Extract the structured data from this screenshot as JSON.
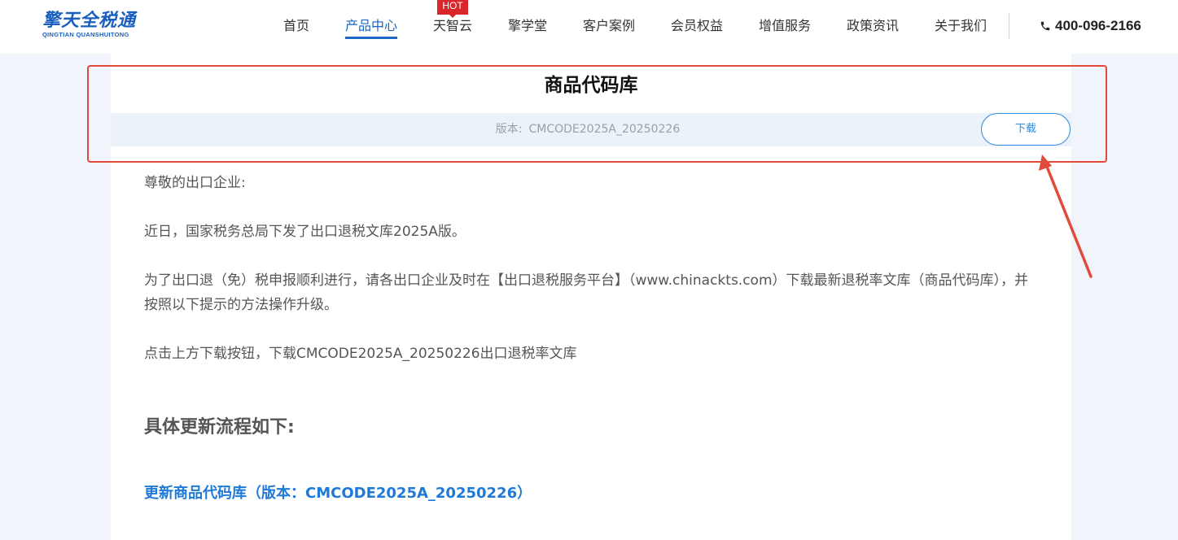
{
  "header": {
    "logo_cn": "擎天全税通",
    "logo_en": "QINGTIAN QUANSHUITONG",
    "nav": [
      {
        "label": "首页"
      },
      {
        "label": "产品中心"
      },
      {
        "label": "天智云"
      },
      {
        "label": "擎学堂"
      },
      {
        "label": "客户案例"
      },
      {
        "label": "会员权益"
      },
      {
        "label": "增值服务"
      },
      {
        "label": "政策资讯"
      },
      {
        "label": "关于我们"
      }
    ],
    "hot_badge": "HOT",
    "phone": "400-096-2166"
  },
  "main": {
    "title": "商品代码库",
    "version_label": "版本:",
    "version_value": "CMCODE2025A_20250226",
    "download_label": "下载",
    "paragraphs": [
      "尊敬的出口企业:",
      "近日，国家税务总局下发了出口退税文库2025A版。",
      "为了出口退（免）税申报顺利进行，请各出口企业及时在【出口退税服务平台】（www.chinackts.com）下载最新退税率文库（商品代码库），并按照以下提示的方法操作升级。",
      "点击上方下载按钮，下载CMCODE2025A_20250226出口退税率文库"
    ],
    "sub_heading": "具体更新流程如下:",
    "link_heading": "更新商品代码库（版本：CMCODE2025A_20250226）"
  },
  "colors": {
    "accent": "#1a66c4",
    "link": "#1e7ad6",
    "highlight": "#e14b3b",
    "hot": "#d9262b"
  }
}
